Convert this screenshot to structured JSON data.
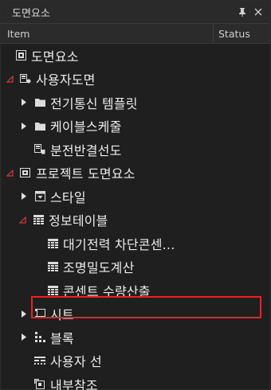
{
  "panel": {
    "title": "도면요소",
    "pin_icon": "pin-icon",
    "close_icon": "close-icon"
  },
  "columns": {
    "item": "Item",
    "status": "Status"
  },
  "tree": [
    {
      "label": "도면요소",
      "icon": "drawing-root-icon",
      "expander": "none"
    },
    {
      "label": "사용자도면",
      "icon": "user-drawings-icon",
      "expander": "expanded"
    },
    {
      "label": "전기통신 템플릿",
      "icon": "folder-icon",
      "expander": "collapsed"
    },
    {
      "label": "케이블스케줄",
      "icon": "folder-icon",
      "expander": "collapsed"
    },
    {
      "label": "분전반결선도",
      "icon": "panel-diagram-icon",
      "expander": "none"
    },
    {
      "label": "프로젝트 도면요소",
      "icon": "project-elements-icon",
      "expander": "expanded"
    },
    {
      "label": "스타일",
      "icon": "style-icon",
      "expander": "collapsed"
    },
    {
      "label": "정보테이블",
      "icon": "table-icon",
      "expander": "expanded"
    },
    {
      "label": "대기전력 차단콘센...",
      "icon": "table-icon",
      "expander": "none"
    },
    {
      "label": "조명밀도계산",
      "icon": "table-icon",
      "expander": "none",
      "highlighted": true
    },
    {
      "label": "콘센트 수량산출",
      "icon": "table-icon",
      "expander": "none"
    },
    {
      "label": "시트",
      "icon": "sheet-icon",
      "expander": "collapsed"
    },
    {
      "label": "블록",
      "icon": "block-icon",
      "expander": "collapsed"
    },
    {
      "label": "사용자 선",
      "icon": "user-line-icon",
      "expander": "none"
    },
    {
      "label": "내부참조",
      "icon": "xref-icon",
      "expander": "none"
    }
  ],
  "colors": {
    "highlight_border": "#e5222a",
    "expanded_arrow": "#d7363c"
  }
}
